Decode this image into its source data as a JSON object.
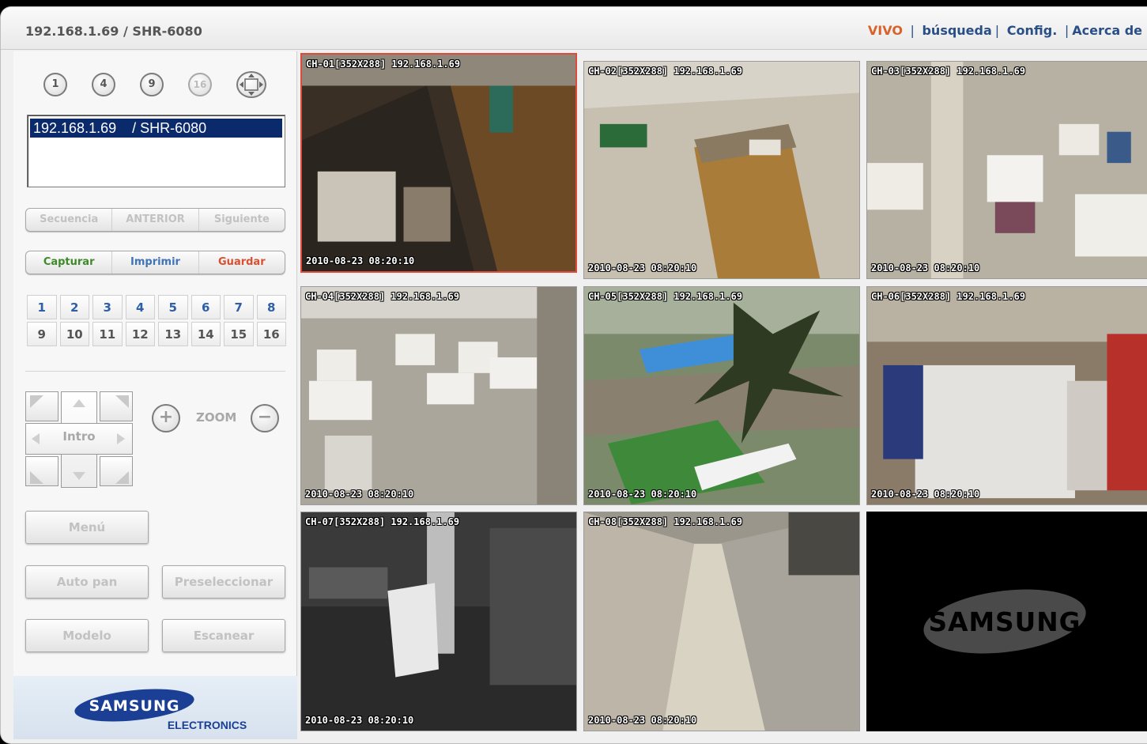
{
  "header": {
    "device_title": "192.168.1.69 / SHR-6080",
    "nav": {
      "live": "VIVO",
      "search": "búsqueda",
      "config": "Config.",
      "about": "Acerca de",
      "separator": "|"
    }
  },
  "layout_buttons": [
    {
      "label": "1",
      "enabled": true
    },
    {
      "label": "4",
      "enabled": true
    },
    {
      "label": "9",
      "enabled": true
    },
    {
      "label": "16",
      "enabled": false
    },
    {
      "icon": "fullscreen-icon"
    }
  ],
  "device_list": {
    "items": [
      "192.168.1.69    / SHR-6080"
    ]
  },
  "sequence_bar": {
    "sequence": "Secuencia",
    "previous": "ANTERIOR",
    "next": "Siguiente"
  },
  "action_bar": {
    "capture": "Capturar",
    "print": "Imprimir",
    "save": "Guardar"
  },
  "channels": {
    "row1": [
      "1",
      "2",
      "3",
      "4",
      "5",
      "6",
      "7",
      "8"
    ],
    "row2": [
      "9",
      "10",
      "11",
      "12",
      "13",
      "14",
      "15",
      "16"
    ]
  },
  "ptz": {
    "center_label": "Intro",
    "zoom_label": "ZOOM",
    "zoom_in_symbol": "+",
    "zoom_out_symbol": "−"
  },
  "function_buttons": {
    "menu": "Menú",
    "auto_pan": "Auto pan",
    "preset": "Preseleccionar",
    "pattern": "Modelo",
    "scan": "Escanear"
  },
  "brand": {
    "name": "SAMSUNG",
    "sub": "ELECTRONICS"
  },
  "cameras": [
    {
      "label": "CH-01[352X288] 192.168.1.69",
      "timestamp": "2010-08-23 08:20:10"
    },
    {
      "label": "CH-02[352X288] 192.168.1.69",
      "timestamp": "2010-08-23 08:20:10"
    },
    {
      "label": "CH-03[352X288] 192.168.1.69",
      "timestamp": "2010-08-23 08:20:10"
    },
    {
      "label": "CH-04[352X288] 192.168.1.69",
      "timestamp": "2010-08-23 08:20:10"
    },
    {
      "label": "CH-05[352X288] 192.168.1.69",
      "timestamp": "2010-08-23 08:20:10"
    },
    {
      "label": "CH-06[352X288] 192.168.1.69",
      "timestamp": "2010-08-23 08:20:10"
    },
    {
      "label": "CH-07[352X288] 192.168.1.69",
      "timestamp": "2010-08-23 08:20:10"
    },
    {
      "label": "CH-08[352X288] 192.168.1.69",
      "timestamp": "2010-08-23 08:20:10"
    }
  ],
  "empty_slot_logo": "SAMSUNG",
  "colors": {
    "accent_live": "#d8622a",
    "nav_blue": "#2a4f86",
    "selected_border": "#e04a3a",
    "list_selected": "#0b2a6b"
  }
}
